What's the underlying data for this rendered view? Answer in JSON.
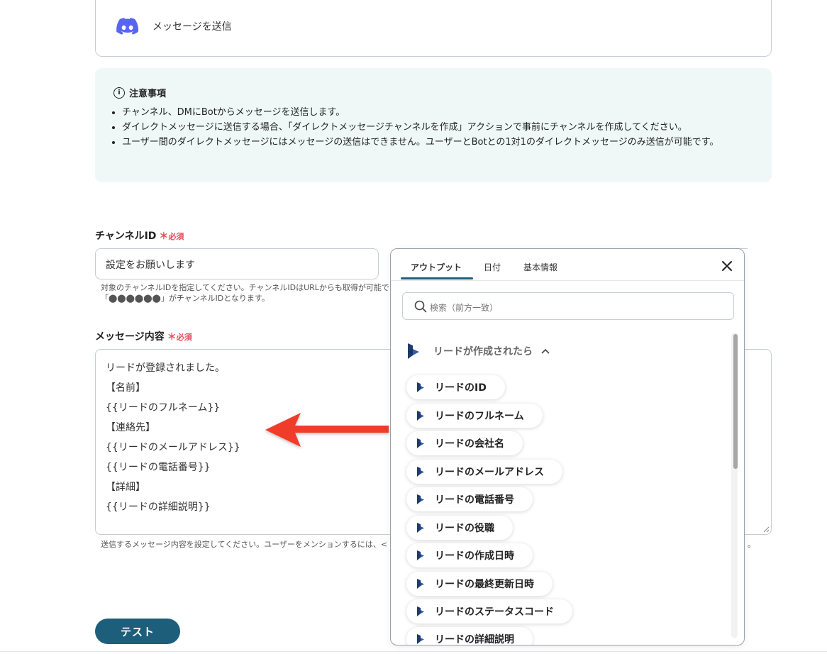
{
  "action": {
    "label": "メッセージを送信"
  },
  "notice": {
    "title": "注意事項",
    "items": [
      "チャンネル、DMにBotからメッセージを送信します。",
      "ダイレクトメッセージに送信する場合、「ダイレクトメッセージチャンネルを作成」アクションで事前にチャンネルを作成してください。",
      "ユーザー間のダイレクトメッセージにはメッセージの送信はできません。ユーザーとBotとの1対1のダイレクトメッセージのみ送信が可能です。"
    ]
  },
  "channel_field": {
    "label": "チャンネルID",
    "required": "必須",
    "value": "設定をお願いします",
    "help_line1": "対象のチャンネルIDを指定してください。チャンネルIDはURLからも取得が可能で",
    "help_line2": "「⬤⬤⬤⬤⬤⬤」がチャンネルIDとなります。"
  },
  "message_field": {
    "label": "メッセージ内容",
    "required": "必須",
    "lines": [
      "リードが登録されました。",
      "【名前】",
      "{{リードのフルネーム}}",
      "【連絡先】",
      "{{リードのメールアドレス}}",
      "{{リードの電話番号}}",
      "【詳細】",
      "{{リードの詳細説明}}"
    ],
    "help_left": "送信するメッセージ内容を設定してください。ユーザーをメンションするには、<",
    "help_right": "。"
  },
  "test_button": {
    "label": "テスト"
  },
  "popup": {
    "tabs": [
      "アウトプット",
      "日付",
      "基本情報"
    ],
    "search_placeholder": "検索（前方一致）",
    "group_title": "リードが作成されたら",
    "items": [
      "リードのID",
      "リードのフルネーム",
      "リードの会社名",
      "リードのメールアドレス",
      "リードの電話番号",
      "リードの役職",
      "リードの作成日時",
      "リードの最終更新日時",
      "リードのステータスコード",
      "リードの詳細説明"
    ]
  },
  "colors": {
    "accent": "#1d5f7a",
    "required": "#e64a5b",
    "discord": "#5865f2",
    "arrow": "#f03c2a",
    "dynamics": "#1f3b6e"
  },
  "icons": [
    "discord-icon",
    "info-icon",
    "close-icon",
    "search-icon",
    "dynamics-icon",
    "chevron-up-icon"
  ]
}
